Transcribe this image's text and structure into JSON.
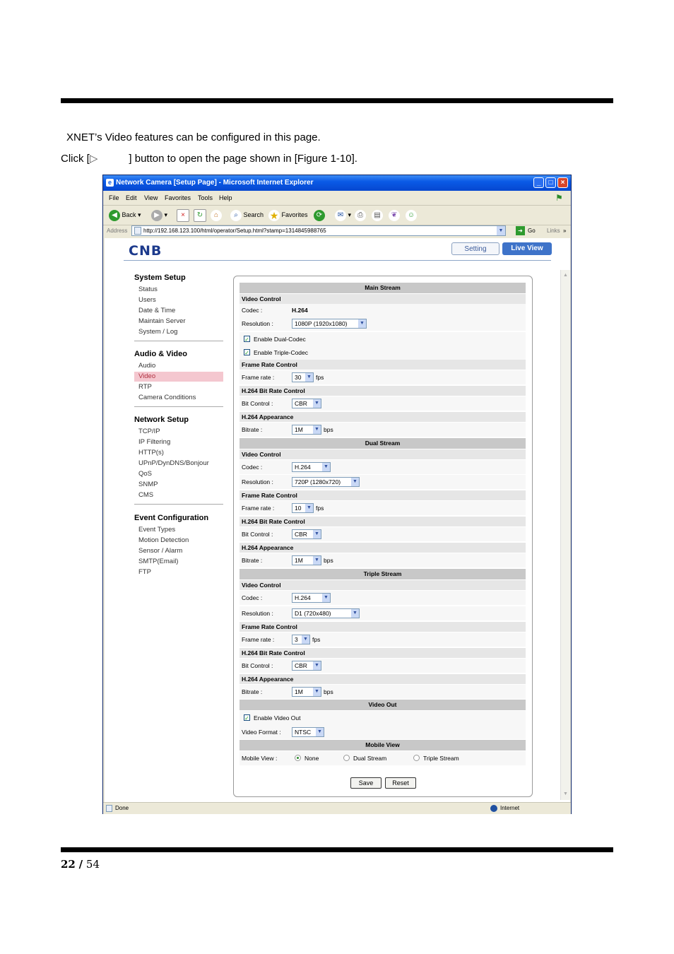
{
  "doc": {
    "intro": "XNET’s Video features can be configured in this page.",
    "click_prefix": "Click [",
    "click_glyph": "▷",
    "click_suffix": "] button to open the page shown in [Figure 1-10].",
    "page_current": "22",
    "page_sep": "/",
    "page_total": "54"
  },
  "browser": {
    "title": "Network Camera [Setup Page] - Microsoft Internet Explorer",
    "menu": [
      "File",
      "Edit",
      "View",
      "Favorites",
      "Tools",
      "Help"
    ],
    "toolbar": {
      "back": "Back",
      "search": "Search",
      "favorites": "Favorites"
    },
    "address_label": "Address",
    "address": "http://192.168.123.100/html/operator/Setup.html?stamp=1314845988765",
    "go": "Go",
    "links": "Links",
    "status_left": "Done",
    "status_right": "Internet"
  },
  "header": {
    "logo": "CNB",
    "setting_button": "Setting",
    "liveview_button": "Live View"
  },
  "nav": {
    "system": {
      "title": "System Setup",
      "items": [
        "Status",
        "Users",
        "Date & Time",
        "Maintain Server",
        "System / Log"
      ]
    },
    "av": {
      "title": "Audio & Video",
      "items": [
        "Audio",
        "Video",
        "RTP",
        "Camera Conditions"
      ]
    },
    "network": {
      "title": "Network Setup",
      "items": [
        "TCP/IP",
        "IP Filtering",
        "HTTP(s)",
        "UPnP/DynDNS/Bonjour",
        "QoS",
        "SNMP",
        "CMS"
      ]
    },
    "event": {
      "title": "Event Configuration",
      "items": [
        "Event Types",
        "Motion Detection",
        "Sensor / Alarm",
        "SMTP(Email)",
        "FTP"
      ]
    }
  },
  "form": {
    "main": {
      "title": "Main Stream",
      "video_control": "Video Control",
      "codec_label": "Codec :",
      "codec": "H.264",
      "resolution_label": "Resolution :",
      "resolution": "1080P (1920x1080)",
      "dual_codec": "Enable Dual-Codec",
      "triple_codec": "Enable Triple-Codec",
      "frc": "Frame Rate Control",
      "framerate_label": "Frame rate :",
      "framerate": "30",
      "fps": "fps",
      "brc": "H.264 Bit Rate Control",
      "bitcontrol_label": "Bit Control :",
      "bitcontrol": "CBR",
      "appearance": "H.264 Appearance",
      "bitrate_label": "Bitrate :",
      "bitrate": "1M",
      "bps": "bps"
    },
    "dual": {
      "title": "Dual Stream",
      "video_control": "Video Control",
      "codec_label": "Codec :",
      "codec": "H.264",
      "resolution_label": "Resolution :",
      "resolution": "720P (1280x720)",
      "frc": "Frame Rate Control",
      "framerate_label": "Frame rate :",
      "framerate": "10",
      "fps": "fps",
      "brc": "H.264 Bit Rate Control",
      "bitcontrol_label": "Bit Control :",
      "bitcontrol": "CBR",
      "appearance": "H.264 Appearance",
      "bitrate_label": "Bitrate :",
      "bitrate": "1M",
      "bps": "bps"
    },
    "triple": {
      "title": "Triple Stream",
      "video_control": "Video Control",
      "codec_label": "Codec :",
      "codec": "H.264",
      "resolution_label": "Resolution :",
      "resolution": "D1 (720x480)",
      "frc": "Frame Rate Control",
      "framerate_label": "Frame rate :",
      "framerate": "3",
      "fps": "fps",
      "brc": "H.264 Bit Rate Control",
      "bitcontrol_label": "Bit Control :",
      "bitcontrol": "CBR",
      "appearance": "H.264 Appearance",
      "bitrate_label": "Bitrate :",
      "bitrate": "1M",
      "bps": "bps"
    },
    "videoout": {
      "title": "Video Out",
      "enable": "Enable Video Out",
      "format_label": "Video Format :",
      "format": "NTSC"
    },
    "mobile": {
      "title": "Mobile View",
      "label": "Mobile View :",
      "opt_none": "None",
      "opt_dual": "Dual Stream",
      "opt_triple": "Triple Stream"
    },
    "save": "Save",
    "reset": "Reset"
  }
}
